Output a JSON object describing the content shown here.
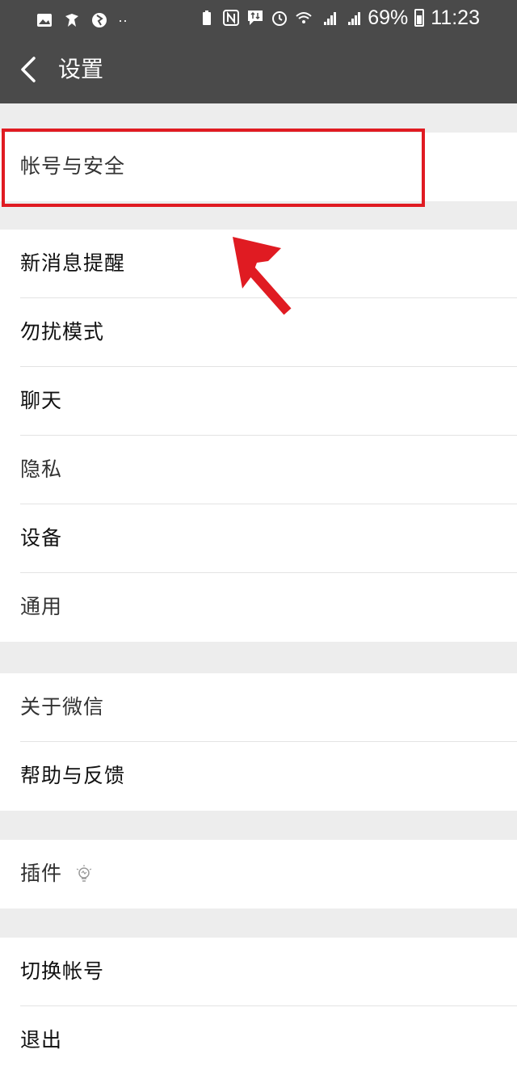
{
  "status_bar": {
    "battery_percent": "69%",
    "time": "11:23",
    "left_icons": [
      "gallery-icon",
      "app-icon",
      "browser-icon",
      "more-dots-icon"
    ],
    "right_icons": [
      "battery-saver-icon",
      "nfc-icon",
      "message-icon",
      "alarm-icon",
      "wifi-icon",
      "4g-signal-icon",
      "2g-signal-icon",
      "battery-icon"
    ]
  },
  "header": {
    "title": "设置",
    "back_icon": "chevron-left-icon"
  },
  "groups": [
    {
      "items": [
        {
          "label": "帐号与安全",
          "highlighted": true
        }
      ]
    },
    {
      "items": [
        {
          "label": "新消息提醒"
        },
        {
          "label": "勿扰模式"
        },
        {
          "label": "聊天"
        },
        {
          "label": "隐私"
        },
        {
          "label": "设备"
        },
        {
          "label": "通用"
        }
      ]
    },
    {
      "items": [
        {
          "label": "关于微信"
        },
        {
          "label": "帮助与反馈"
        }
      ]
    },
    {
      "items": [
        {
          "label": "插件",
          "icon": "lightbulb-icon"
        }
      ]
    },
    {
      "items": [
        {
          "label": "切换帐号"
        },
        {
          "label": "退出"
        }
      ]
    }
  ],
  "colors": {
    "header_bg": "#4a4a4a",
    "page_bg": "#ededed",
    "annotation_red": "#e01b22"
  }
}
